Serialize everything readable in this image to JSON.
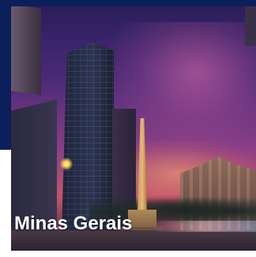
{
  "card": {
    "title": "Minas Gerais",
    "image_icon": "city-skyline-photo"
  },
  "colors": {
    "accent": "#0b1f5a",
    "title_text": "#ffffff"
  }
}
